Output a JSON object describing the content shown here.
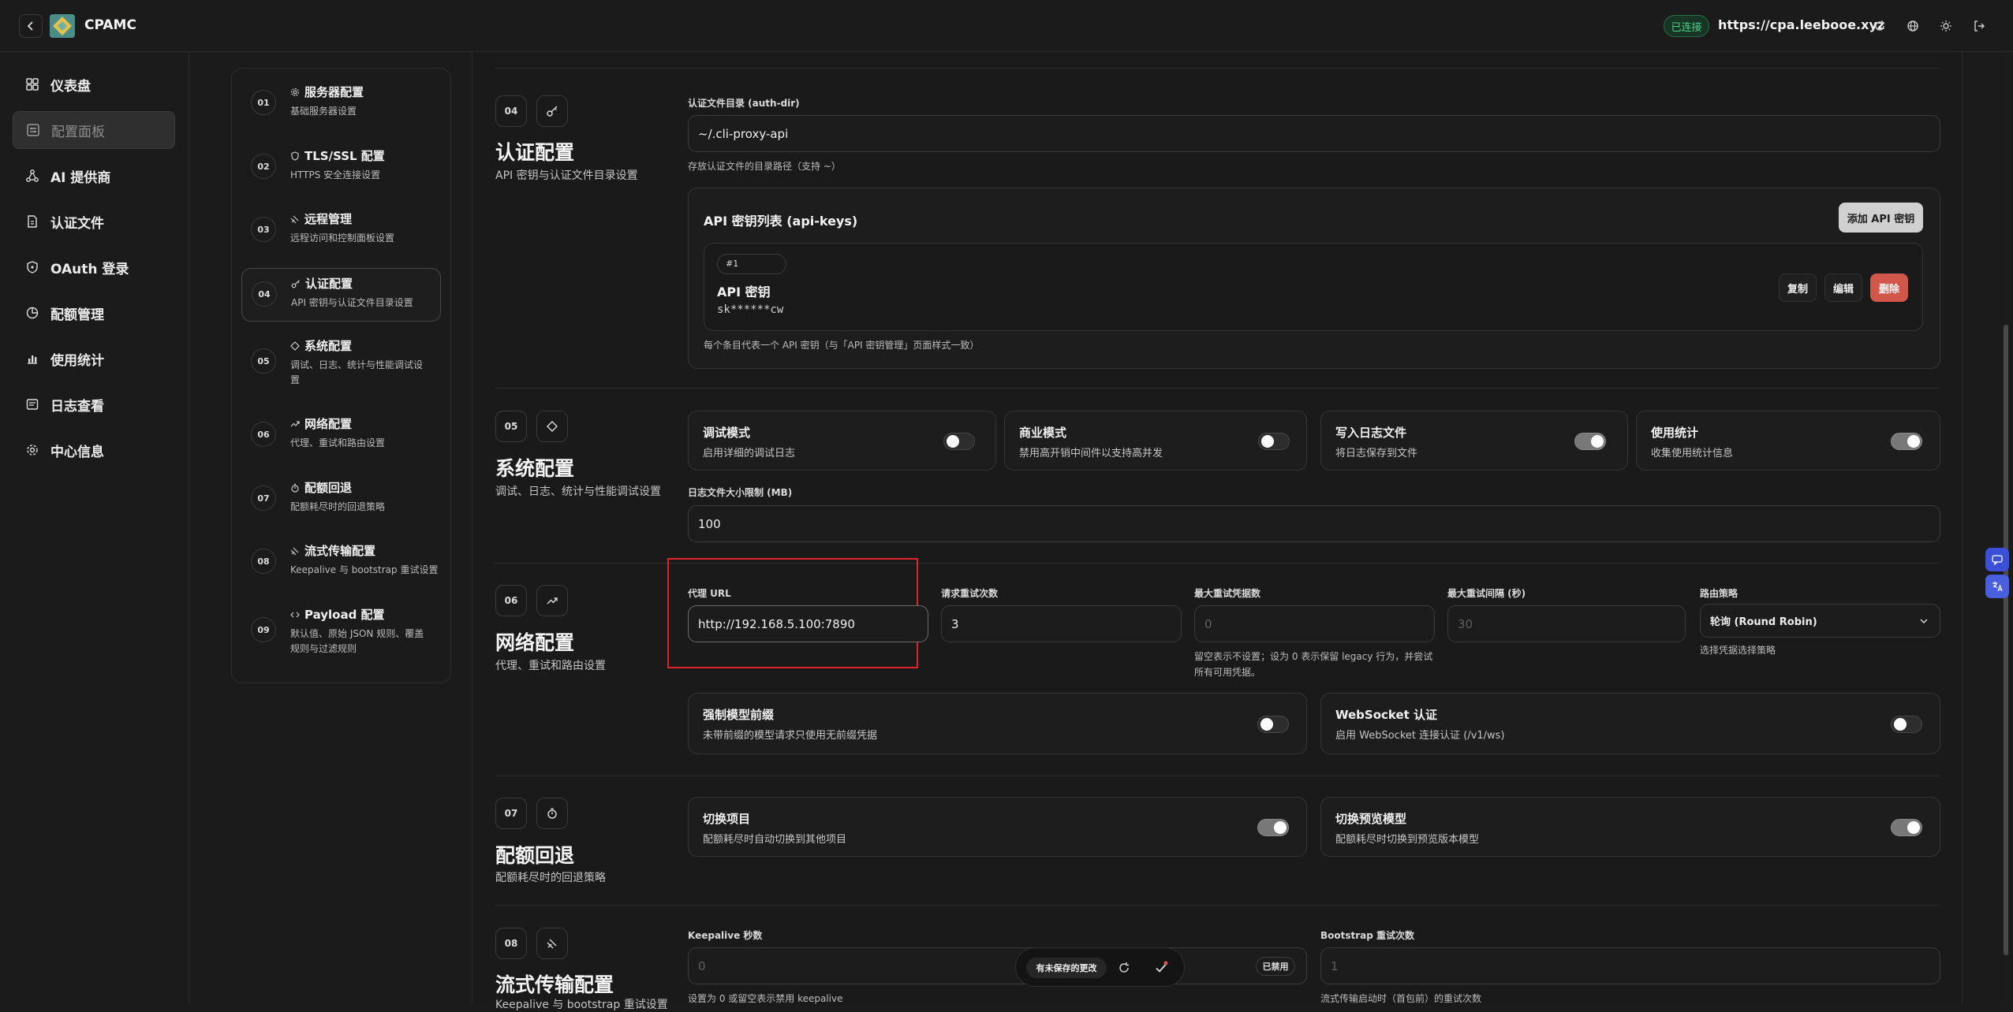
{
  "app": {
    "name": "CPAMC"
  },
  "header": {
    "status": "已连接",
    "url": "https://cpa.leebooe.xyz"
  },
  "sidebar": {
    "items": [
      {
        "label": "仪表盘"
      },
      {
        "label": "配置面板"
      },
      {
        "label": "AI 提供商"
      },
      {
        "label": "认证文件"
      },
      {
        "label": "OAuth 登录"
      },
      {
        "label": "配额管理"
      },
      {
        "label": "使用统计"
      },
      {
        "label": "日志查看"
      },
      {
        "label": "中心信息"
      }
    ]
  },
  "toc": {
    "items": [
      {
        "num": "01",
        "title": "服务器配置",
        "sub": "基础服务器设置"
      },
      {
        "num": "02",
        "title": "TLS/SSL 配置",
        "sub": "HTTPS 安全连接设置"
      },
      {
        "num": "03",
        "title": "远程管理",
        "sub": "远程访问和控制面板设置"
      },
      {
        "num": "04",
        "title": "认证配置",
        "sub": "API 密钥与认证文件目录设置"
      },
      {
        "num": "05",
        "title": "系统配置",
        "sub": "调试、日志、统计与性能调试设置"
      },
      {
        "num": "06",
        "title": "网络配置",
        "sub": "代理、重试和路由设置"
      },
      {
        "num": "07",
        "title": "配额回退",
        "sub": "配额耗尽时的回退策略"
      },
      {
        "num": "08",
        "title": "流式传输配置",
        "sub": "Keepalive 与 bootstrap 重试设置"
      },
      {
        "num": "09",
        "title": "Payload 配置",
        "sub": "默认值、原始 JSON 规则、覆盖规则与过滤规则"
      }
    ]
  },
  "auth": {
    "num": "04",
    "title": "认证配置",
    "sub": "API 密钥与认证文件目录设置",
    "dir_label": "认证文件目录 (auth-dir)",
    "dir_value": "~/.cli-proxy-api",
    "dir_help": "存放认证文件的目录路径（支持 ~）",
    "keys_title": "API 密钥列表 (api-keys)",
    "add_button": "添加 API 密钥",
    "key": {
      "index": "#1",
      "name": "API 密钥",
      "masked": "sk******cw",
      "copy": "复制",
      "edit": "编辑",
      "delete": "删除"
    },
    "keys_help": "每个条目代表一个 API 密钥（与「API 密钥管理」页面样式一致）"
  },
  "system": {
    "num": "05",
    "title": "系统配置",
    "sub": "调试、日志、统计与性能调试设置",
    "toggles": [
      {
        "title": "调试模式",
        "sub": "启用详细的调试日志",
        "on": false
      },
      {
        "title": "商业模式",
        "sub": "禁用高开销中间件以支持高并发",
        "on": false
      },
      {
        "title": "写入日志文件",
        "sub": "将日志保存到文件",
        "on": true
      },
      {
        "title": "使用统计",
        "sub": "收集使用统计信息",
        "on": true
      }
    ],
    "log_size_label": "日志文件大小限制 (MB)",
    "log_size_value": "100"
  },
  "network": {
    "num": "06",
    "title": "网络配置",
    "sub": "代理、重试和路由设置",
    "proxy_label": "代理 URL",
    "proxy_value": "http://192.168.5.100:7890",
    "retry_label": "请求重试次数",
    "retry_value": "3",
    "max_cred_label": "最大重试凭据数",
    "max_cred_placeholder": "0",
    "max_cred_help": "留空表示不设置；设为 0 表示保留 legacy 行为，并尝试所有可用凭据。",
    "max_interval_label": "最大重试间隔 (秒)",
    "max_interval_placeholder": "30",
    "routing_label": "路由策略",
    "routing_value": "轮询 (Round Robin)",
    "routing_help": "选择凭据选择策略",
    "toggles": [
      {
        "title": "强制模型前缀",
        "sub": "未带前缀的模型请求只使用无前缀凭据",
        "on": false
      },
      {
        "title": "WebSocket 认证",
        "sub": "启用 WebSocket 连接认证 (/v1/ws)",
        "on": false
      }
    ]
  },
  "quota": {
    "num": "07",
    "title": "配额回退",
    "sub": "配额耗尽时的回退策略",
    "toggles": [
      {
        "title": "切换项目",
        "sub": "配额耗尽时自动切换到其他项目",
        "on": true
      },
      {
        "title": "切换预览模型",
        "sub": "配额耗尽时切换到预览版本模型",
        "on": true
      }
    ]
  },
  "streaming": {
    "num": "08",
    "title": "流式传输配置",
    "sub": "Keepalive 与 bootstrap 重试设置",
    "keepalive_label": "Keepalive 秒数",
    "keepalive_placeholder": "0",
    "keepalive_badge": "已禁用",
    "keepalive_help": "设置为 0 或留空表示禁用 keepalive",
    "bootstrap_label": "Bootstrap 重试次数",
    "bootstrap_placeholder": "1",
    "bootstrap_help": "流式传输启动时（首包前）的重试次数"
  },
  "floatbar": {
    "unsaved": "有未保存的更改"
  },
  "colors": {
    "accent_green": "#3fbf7a",
    "danger": "#d2574b",
    "highlight": "#e0242c"
  }
}
